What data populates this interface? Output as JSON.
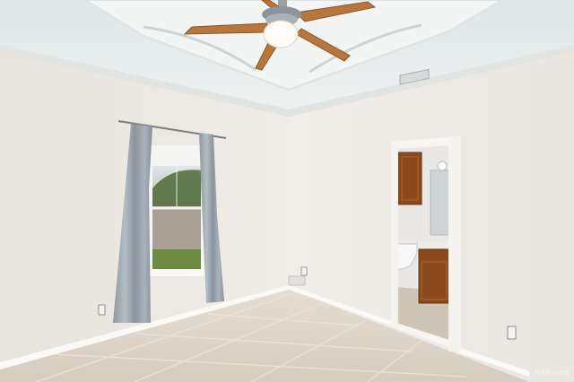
{
  "scene": {
    "colors": {
      "ceiling": "#e8eceb",
      "left_wall": "#ebe7e2",
      "right_wall": "#eeebe7",
      "floor": "#d9cfc3",
      "curtain": "#9aa3ad",
      "fan_blade": "#b8763f",
      "cabinet": "#8a4a1e",
      "baseboard": "#f7f7f5"
    },
    "watermark": "HAR.com"
  }
}
